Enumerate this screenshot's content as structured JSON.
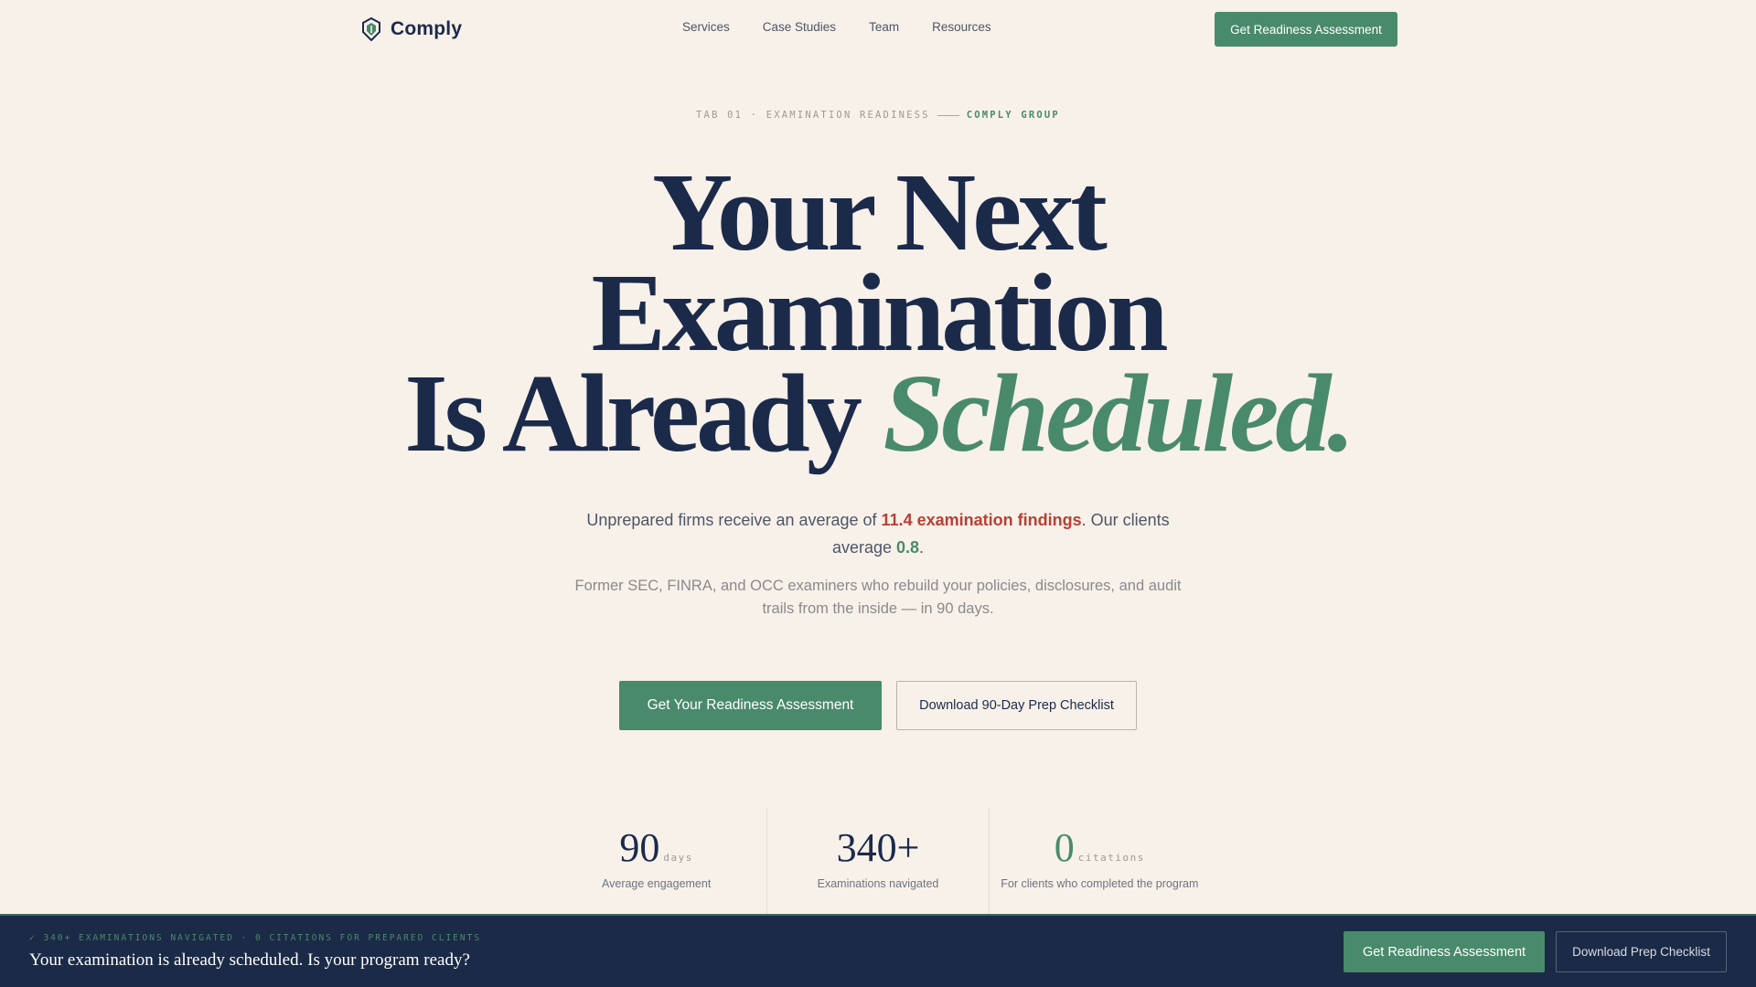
{
  "nav": {
    "brand": "Comply",
    "logo_icon": "shield-hexagon-icon",
    "links": [
      "Services",
      "Case Studies",
      "Team",
      "Resources"
    ],
    "cta": "Get Readiness Assessment"
  },
  "hero": {
    "eyebrow_prefix": "TAB 01 · EXAMINATION READINESS",
    "eyebrow_brand": "COMPLY GROUP",
    "headline_line1": "Your Next",
    "headline_line2": "Examination",
    "headline_line3_plain": "Is Already",
    "headline_line3_accent": "Scheduled.",
    "sub_prefix": "Unprepared firms receive an average of",
    "sub_highlight_bad": "11.4 examination findings",
    "sub_middle": ". Our clients average",
    "sub_highlight_good": "0.8",
    "sub_suffix": ".",
    "sub2": "Former SEC, FINRA, and OCC examiners who rebuild your policies, disclosures, and audit trails from the inside — in 90 days.",
    "cta_primary": "Get Your Readiness Assessment",
    "cta_secondary": "Download 90-Day Prep Checklist"
  },
  "stats": [
    {
      "value": "90",
      "unit": "days",
      "label": "Average engagement"
    },
    {
      "value": "340+",
      "unit": "",
      "label": "Examinations navigated"
    },
    {
      "value": "0",
      "unit": "citations",
      "label": "For clients who completed the program"
    }
  ],
  "bottom_bar": {
    "eyebrow": "✓ 340+ EXAMINATIONS NAVIGATED · 0 CITATIONS FOR PREPARED CLIENTS",
    "title": "Your examination is already scheduled. Is your program ready?",
    "cta_primary": "Get Readiness Assessment",
    "cta_secondary": "Download Prep Checklist"
  },
  "colors": {
    "background": "#f7f1ea",
    "navy": "#1c2a4a",
    "accent_green": "#4a8a6c",
    "alert_red": "#b84033",
    "bar_background": "#1b2a46"
  }
}
